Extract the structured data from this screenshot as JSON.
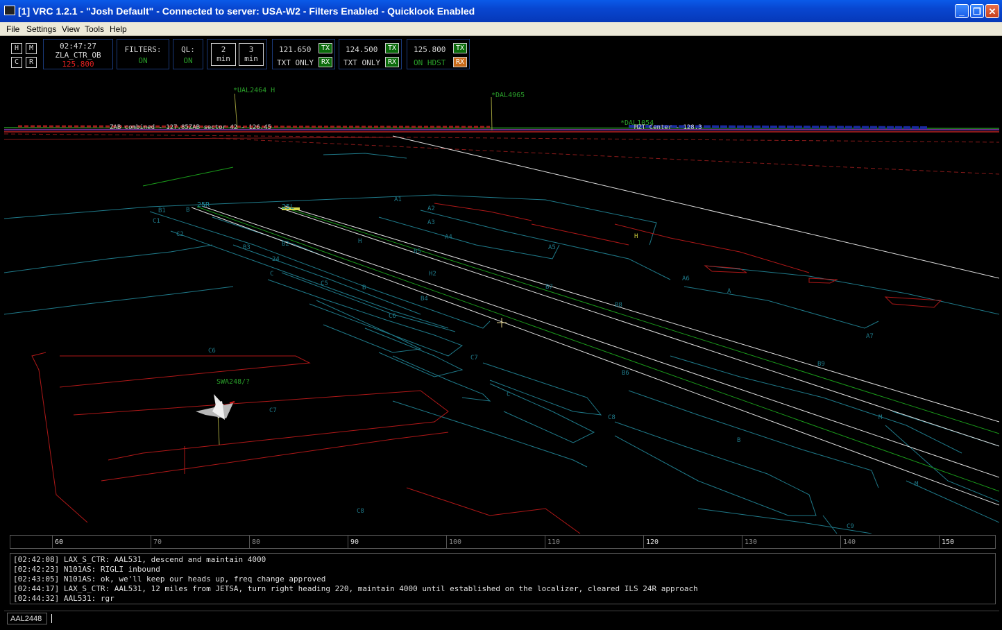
{
  "window": {
    "title": "[1] VRC 1.2.1 - \"Josh Default\" - Connected to server: USA-W2 - Filters Enabled - Quicklook Enabled",
    "minimize": "_",
    "maximize": "❐",
    "close": "✕"
  },
  "menu": [
    "File",
    "Settings",
    "View",
    "Tools",
    "Help"
  ],
  "toolbar": {
    "hmcr": [
      "H",
      "M",
      "C",
      "R"
    ],
    "time": "02:47:27",
    "callsign": "ZLA_CTR_OB",
    "primary_freq": "125.800",
    "filters_label": "FILTERS:",
    "filters_value": "ON",
    "ql_label": "QL:",
    "ql_value": "ON",
    "timer1_num": "2",
    "timer1_unit": "min",
    "timer2_num": "3",
    "timer2_unit": "min",
    "radios": [
      {
        "freq": "121.650",
        "mode": "TXT ONLY",
        "tx": "TX",
        "rx": "RX"
      },
      {
        "freq": "124.500",
        "mode": "TXT ONLY",
        "tx": "TX",
        "rx": "RX"
      },
      {
        "freq": "125.800",
        "mode": "ON HDST",
        "tx": "TX",
        "rx": "RX"
      }
    ]
  },
  "colors": {
    "taxiway": "#1f7a8a",
    "apron": "#b01818",
    "runway": "#e0e0e0",
    "centerline": "#1a9a1a",
    "target_tag": "#2aa02a"
  },
  "scope": {
    "targets": [
      {
        "tag": "*UAL2464 H"
      },
      {
        "tag": "*DAL4965"
      },
      {
        "tag": "*DAL1054"
      },
      {
        "tag": "SWA248/?"
      }
    ],
    "labels": {
      "zab": "ZAB combined - 127.85ZAB sector 42 - 126.45",
      "mzt": "MZT Center - 128.3",
      "rwy_25r": "25R",
      "rwy_25l": "25L",
      "holdshort": "H"
    },
    "taxiway_labels": [
      "B1",
      "B",
      "C1",
      "C2",
      "B3",
      "B2",
      "24",
      "C",
      "C5",
      "B",
      "C6",
      "B4",
      "B5",
      "C7",
      "C",
      "C8",
      "B",
      "A1",
      "A2",
      "A3",
      "A4",
      "A5",
      "A6",
      "A7",
      "B6",
      "B7",
      "B8",
      "H",
      "H2",
      "M",
      "M",
      "C6",
      "C7",
      "C8",
      "C9",
      "B9",
      "A"
    ]
  },
  "ruler": {
    "labels": [
      "60",
      "70",
      "80",
      "90",
      "100",
      "110",
      "120",
      "130",
      "140",
      "150"
    ],
    "major": [
      "60",
      "90",
      "120",
      "150"
    ]
  },
  "chat": [
    "[02:42:08] LAX_S_CTR: AAL531, descend and maintain 4000",
    "[02:42:23] N101AS: RIGLI inbound",
    "[02:43:05] N101AS: ok, we'll keep our heads up, freq change approved",
    "[02:44:17] LAX_S_CTR: AAL531, 12 miles from JETSA, turn right heading 220, maintain 4000 until established on the localizer, cleared ILS 24R approach",
    "[02:44:32] AAL531: rgr"
  ],
  "command": {
    "callsign": "AAL2448"
  }
}
